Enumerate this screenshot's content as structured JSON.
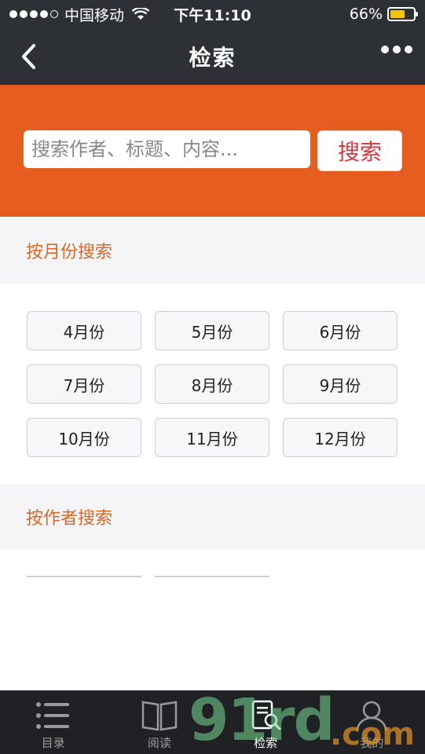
{
  "status_bar": {
    "carrier": "中国移动",
    "time": "下午11:10",
    "battery_percent": "66%",
    "battery_level": 0.66,
    "signal_bars_filled": 4,
    "signal_bars_total": 5
  },
  "nav": {
    "title": "检索",
    "back_icon": "chevron-left-icon",
    "more_icon": "more-dots-icon"
  },
  "search": {
    "placeholder": "搜索作者、标题、内容...",
    "value": "",
    "button_label": "搜索"
  },
  "sections": {
    "by_month": "按月份搜索",
    "by_author": "按作者搜索"
  },
  "months": [
    "4月份",
    "5月份",
    "6月份",
    "7月份",
    "8月份",
    "9月份",
    "10月份",
    "11月份",
    "12月份"
  ],
  "tabs": [
    {
      "label": "目录",
      "icon": "list-icon",
      "active": false
    },
    {
      "label": "阅读",
      "icon": "book-icon",
      "active": false
    },
    {
      "label": "检索",
      "icon": "search-doc-icon",
      "active": true
    },
    {
      "label": "我的",
      "icon": "user-icon",
      "active": false
    }
  ],
  "watermark": {
    "main": "91rd",
    "suffix": ".com"
  },
  "colors": {
    "header_bg": "#2d3034",
    "accent_orange": "#e55e1f",
    "section_title": "#d36a2a",
    "search_button_text": "#d9363e",
    "battery": "#f5c400"
  }
}
